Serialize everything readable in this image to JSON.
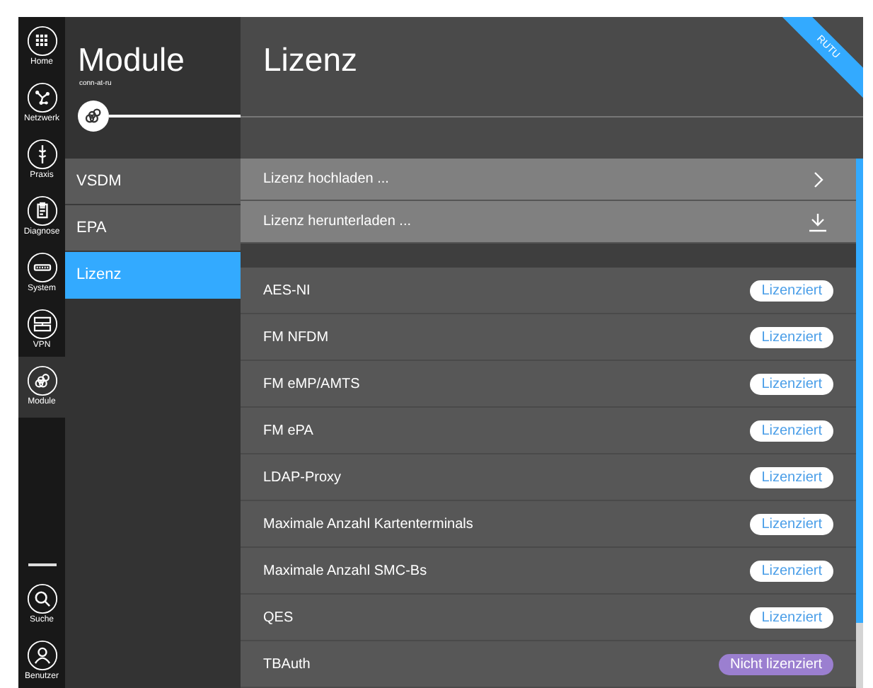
{
  "rail": {
    "items": [
      {
        "label": "Home",
        "kind": "grid",
        "selected": false
      },
      {
        "label": "Netzwerk",
        "kind": "network",
        "selected": false
      },
      {
        "label": "Praxis",
        "kind": "staff",
        "selected": false
      },
      {
        "label": "Diagnose",
        "kind": "clipboard",
        "selected": false
      },
      {
        "label": "System",
        "kind": "device",
        "selected": false
      },
      {
        "label": "VPN",
        "kind": "vpn",
        "selected": false
      },
      {
        "label": "Module",
        "kind": "modules",
        "selected": true
      }
    ],
    "bottom": [
      {
        "label": "Suche",
        "kind": "search"
      },
      {
        "label": "Benutzer",
        "kind": "user"
      }
    ]
  },
  "module_panel": {
    "title": "Module",
    "subtitle": "conn-at-ru",
    "items": [
      {
        "label": "VSDM",
        "selected": false
      },
      {
        "label": "EPA",
        "selected": false
      },
      {
        "label": "Lizenz",
        "selected": true
      }
    ]
  },
  "main": {
    "title": "Lizenz",
    "ribbon": "RUTU",
    "actions": [
      {
        "label": "Lizenz hochladen ...",
        "kind": "chevron"
      },
      {
        "label": "Lizenz herunterladen ...",
        "kind": "download"
      }
    ],
    "licenses": [
      {
        "name": "AES-NI",
        "status": "Lizenziert",
        "licensed": true
      },
      {
        "name": "FM NFDM",
        "status": "Lizenziert",
        "licensed": true
      },
      {
        "name": "FM eMP/AMTS",
        "status": "Lizenziert",
        "licensed": true
      },
      {
        "name": "FM ePA",
        "status": "Lizenziert",
        "licensed": true
      },
      {
        "name": "LDAP-Proxy",
        "status": "Lizenziert",
        "licensed": true
      },
      {
        "name": "Maximale Anzahl Kartenterminals",
        "status": "Lizenziert",
        "licensed": true
      },
      {
        "name": "Maximale Anzahl SMC-Bs",
        "status": "Lizenziert",
        "licensed": true
      },
      {
        "name": "QES",
        "status": "Lizenziert",
        "licensed": true
      },
      {
        "name": "TBAuth",
        "status": "Nicht lizenziert",
        "licensed": false
      }
    ]
  }
}
